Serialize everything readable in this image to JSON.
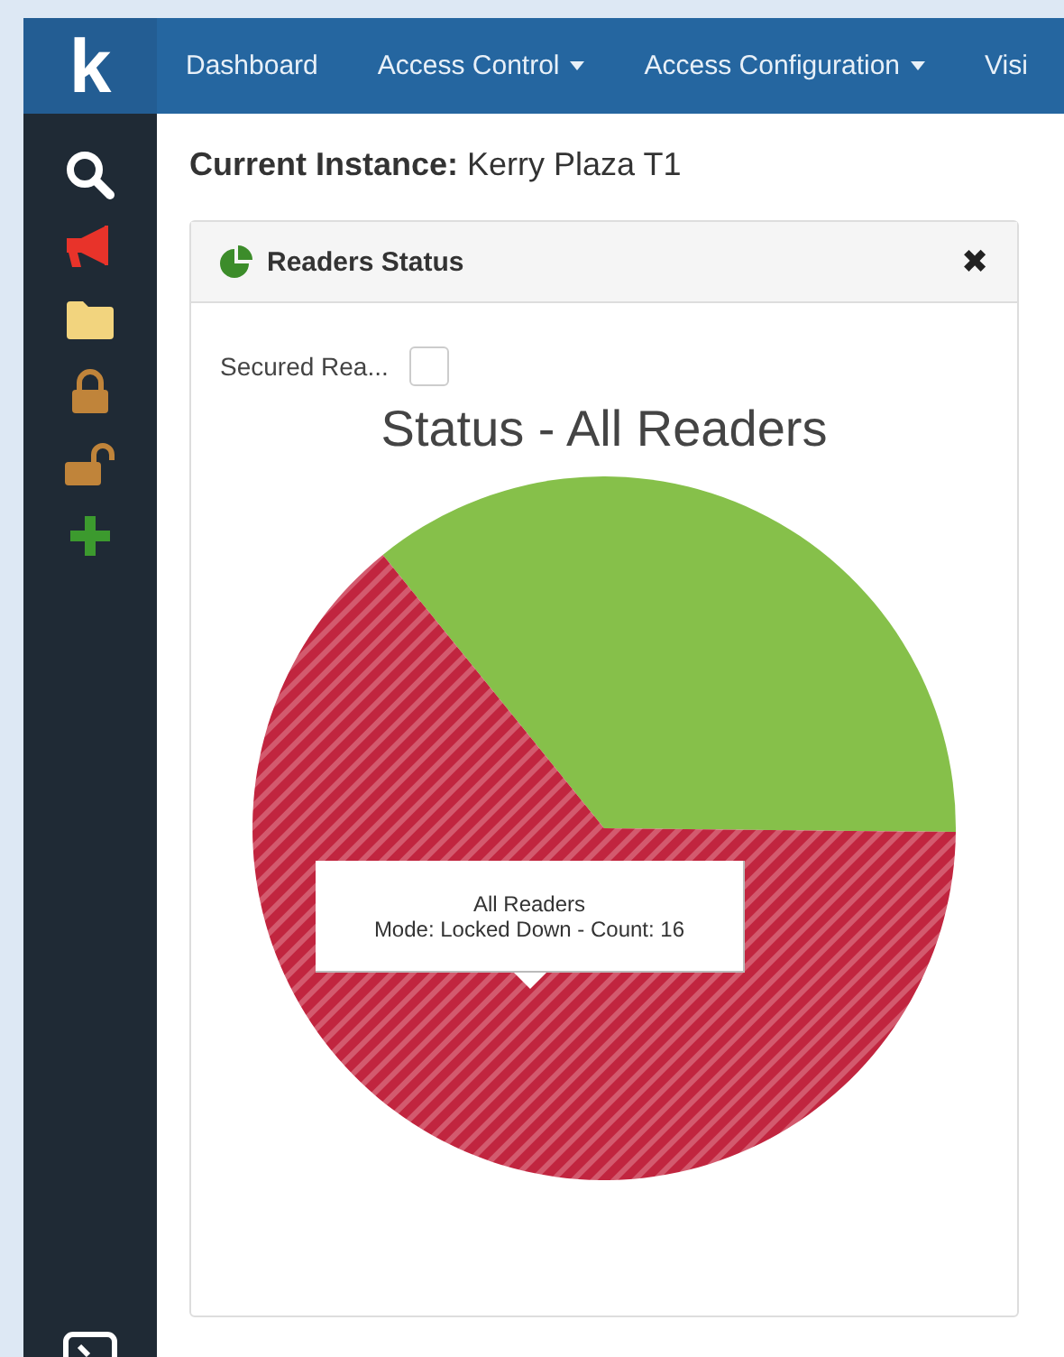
{
  "brand": {
    "logo": "k"
  },
  "nav": [
    {
      "label": "Dashboard",
      "dropdown": false
    },
    {
      "label": "Access Control",
      "dropdown": true
    },
    {
      "label": "Access Configuration",
      "dropdown": true
    },
    {
      "label": "Visi",
      "dropdown": false
    }
  ],
  "sidebar": {
    "items": [
      {
        "kind": "search"
      },
      {
        "kind": "megaphone"
      },
      {
        "kind": "folder"
      },
      {
        "kind": "lock"
      },
      {
        "kind": "unlock"
      },
      {
        "kind": "plus"
      }
    ]
  },
  "instance": {
    "label": "Current Instance:",
    "value": "Kerry Plaza T1"
  },
  "panel": {
    "title": "Readers Status",
    "close": "✖",
    "filter": {
      "label": "Secured Rea...",
      "checked": false
    },
    "chart_data": {
      "type": "pie",
      "title": "Status - All Readers",
      "values": [
        36,
        64
      ]
    },
    "tooltip": {
      "title": "All Readers",
      "text": "Mode: Locked Down - Count: 16"
    }
  }
}
